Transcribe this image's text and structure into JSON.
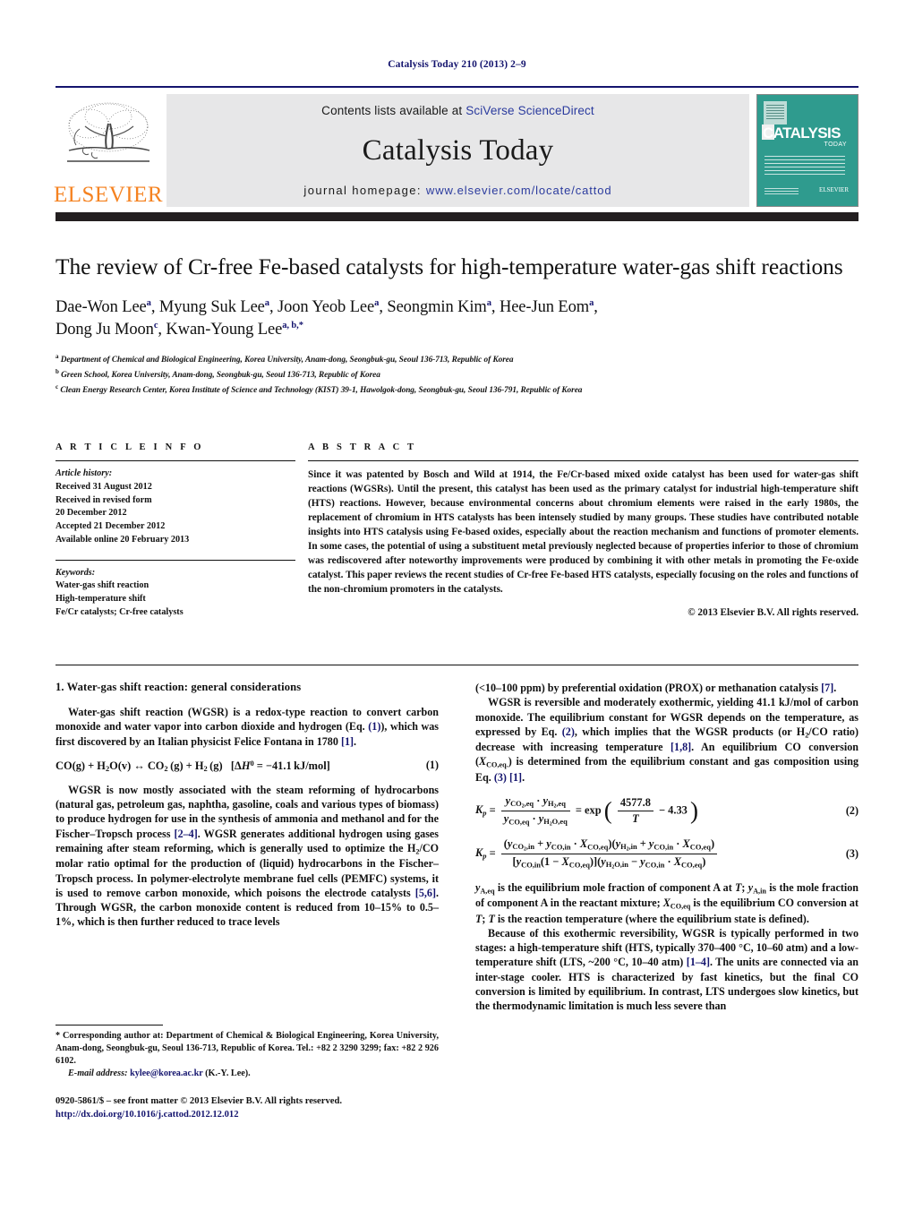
{
  "running_head": "Catalysis Today 210 (2013) 2–9",
  "masthead": {
    "contents_prefix": "Contents lists available at ",
    "contents_brand": "SciVerse ScienceDirect",
    "journal_title": "Catalysis Today",
    "homepage_prefix": "journal homepage: ",
    "homepage_url": "www.elsevier.com/locate/cattod",
    "publisher_logo_word": "ELSEVIER",
    "cover": {
      "title": "CATALYSIS",
      "subtitle": "TODAY",
      "elsevier_mark": "ELSEVIER",
      "color": "#2f9b8e"
    },
    "rule_color": "#14146e",
    "bar_color": "#231f20"
  },
  "article": {
    "title": "The review of Cr-free Fe-based catalysts for high-temperature water-gas shift reactions",
    "authors_line1": "Dae-Won Lee<sup>a</sup>, Myung Suk Lee<sup>a</sup>, Joon Yeob Lee<sup>a</sup>, Seongmin Kim<sup>a</sup>, Hee-Jun Eom<sup>a</sup>,",
    "authors_line2": "Dong Ju Moon<sup>c</sup>, Kwan-Young Lee<sup>a, b,</sup><sup>*</sup>",
    "affiliations": [
      "<sup>a</sup> Department of Chemical and Biological Engineering, Korea University, Anam-dong, Seongbuk-gu, Seoul 136-713, Republic of Korea",
      "<sup>b</sup> Green School, Korea University, Anam-dong, Seongbuk-gu, Seoul 136-713, Republic of Korea",
      "<sup>c</sup> Clean Energy Research Center, Korea Institute of Science and Technology (KIST) 39-1, Hawolgok-dong, Seongbuk-gu, Seoul 136-791, Republic of Korea"
    ]
  },
  "article_info": {
    "heading": "A R T I C L E   I N F O",
    "history_label": "Article history:",
    "history": [
      "Received 31 August 2012",
      "Received in revised form",
      "20 December 2012",
      "Accepted 21 December 2012",
      "Available online 20 February 2013"
    ],
    "keywords_label": "Keywords:",
    "keywords": [
      "Water-gas shift reaction",
      "High-temperature shift",
      "Fe/Cr catalysts; Cr-free catalysts"
    ]
  },
  "abstract": {
    "heading": "A B S T R A C T",
    "text": "Since it was patented by Bosch and Wild at 1914, the Fe/Cr-based mixed oxide catalyst has been used for water-gas shift reactions (WGSRs). Until the present, this catalyst has been used as the primary catalyst for industrial high-temperature shift (HTS) reactions. However, because environmental concerns about chromium elements were raised in the early 1980s, the replacement of chromium in HTS catalysts has been intensely studied by many groups. These studies have contributed notable insights into HTS catalysis using Fe-based oxides, especially about the reaction mechanism and functions of promoter elements. In some cases, the potential of using a substituent metal previously neglected because of properties inferior to those of chromium was rediscovered after noteworthy improvements were produced by combining it with other metals in promoting the Fe-oxide catalyst. This paper reviews the recent studies of Cr-free Fe-based HTS catalysts, especially focusing on the roles and functions of the non-chromium promoters in the catalysts.",
    "copyright": "© 2013 Elsevier B.V. All rights reserved."
  },
  "body": {
    "section_title": "1.  Water-gas shift reaction: general considerations",
    "left_paragraph_1": "Water-gas shift reaction (WGSR) is a redox-type reaction to convert carbon monoxide and water vapor into carbon dioxide and hydrogen (Eq. <span class=\"ref\">(1)</span>), which was first discovered by an Italian physicist Felice Fontana in 1780 <span class=\"ref\">[1]</span>.",
    "equation_1_number": "(1)",
    "left_paragraph_2": "WGSR is now mostly associated with the steam reforming of hydrocarbons (natural gas, petroleum gas, naphtha, gasoline, coals and various types of biomass) to produce hydrogen for use in the synthesis of ammonia and methanol and for the Fischer–Tropsch process <span class=\"ref\">[2–4]</span>. WGSR generates additional hydrogen using gases remaining after steam reforming, which is generally used to optimize the H<sub>2</sub>/CO molar ratio optimal for the production of (liquid) hydrocarbons in the Fischer–Tropsch process. In polymer-electrolyte membrane fuel cells (PEMFC) systems, it is used to remove carbon monoxide, which poisons the electrode catalysts <span class=\"ref\">[5,6]</span>. Through WGSR, the carbon monoxide content is reduced from 10–15% to 0.5–1%, which is then further reduced to trace levels",
    "right_paragraph_1": "(&lt;10–100 ppm) by preferential oxidation (PROX) or methanation catalysis <span class=\"ref\">[7]</span>.",
    "right_paragraph_2": "WGSR is reversible and moderately exothermic, yielding 41.1 kJ/mol of carbon monoxide. The equilibrium constant for WGSR depends on the temperature, as expressed by Eq. <span class=\"ref\">(2)</span>, which implies that the WGSR products (or H<sub>2</sub>/CO ratio) decrease with increasing temperature <span class=\"ref\">[1,8]</span>. An equilibrium CO conversion (<span class=\"ital\">X</span><sub>CO,eq.</sub>) is determined from the equilibrium constant and gas composition using Eq. <span class=\"ref\">(3)</span> <span class=\"ref\">[1]</span>.",
    "equation_2_number": "(2)",
    "equation_3_number": "(3)",
    "right_paragraph_3": "<span class=\"ital\">y</span><sub>A,eq</sub> is the equilibrium mole fraction of component A at <span class=\"ital\">T</span>; <span class=\"ital\">y</span><sub>A,in</sub> is the mole fraction of component A in the reactant mixture; <span class=\"ital\">X</span><sub>CO,eq</sub> is the equilibrium CO conversion at <span class=\"ital\">T</span>; <span class=\"ital\">T</span> is the reaction temperature (where the equilibrium state is defined).",
    "right_paragraph_4": "Because of this exothermic reversibility, WGSR is typically performed in two stages: a high-temperature shift (HTS, typically 370–400 °C, 10–60 atm) and a low-temperature shift (LTS, ~200 °C, 10–40 atm) <span class=\"ref\">[1–4]</span>. The units are connected via an inter-stage cooler. HTS is characterized by fast kinetics, but the final CO conversion is limited by equilibrium. In contrast, LTS undergoes slow kinetics, but the thermodynamic limitation is much less severe than"
  },
  "footnote": {
    "corresponding": "* Corresponding author at: Department of Chemical &amp; Biological Engineering, Korea University, Anam-dong, Seongbuk-gu, Seoul 136-713, Republic of Korea. Tel.: +82 2 3290 3299; fax: +82 2 926 6102.",
    "email_label": "E-mail address:",
    "email": "kylee@korea.ac.kr",
    "email_suffix": "(K.-Y. Lee)."
  },
  "imprint": {
    "line1": "0920-5861/$ – see front matter © 2013 Elsevier B.V. All rights reserved.",
    "doi": "http://dx.doi.org/10.1016/j.cattod.2012.12.012"
  }
}
